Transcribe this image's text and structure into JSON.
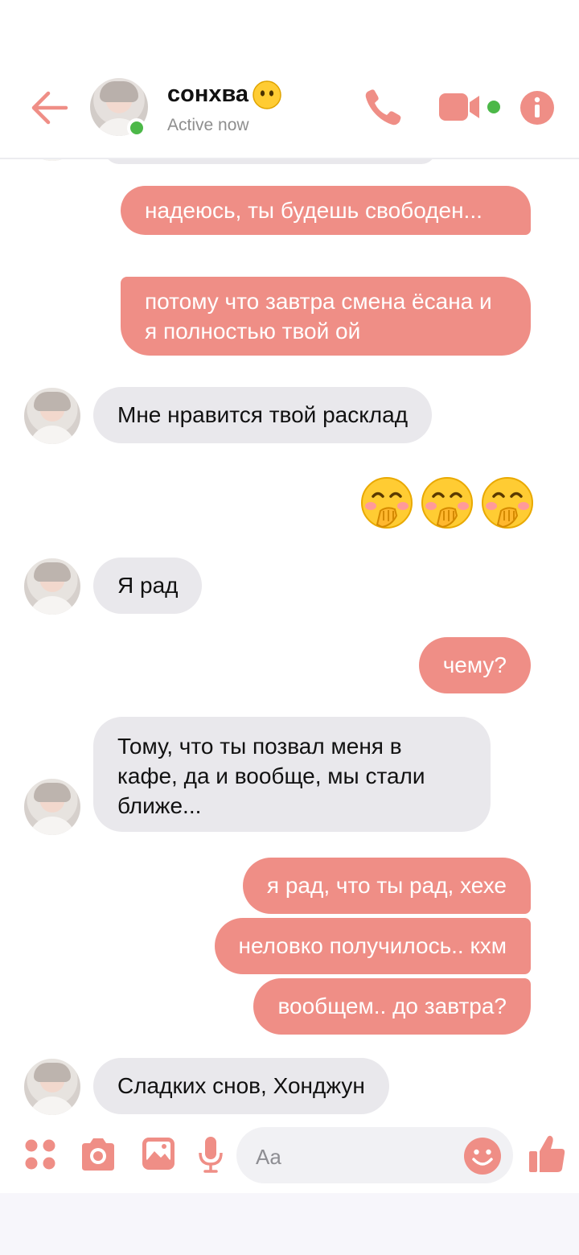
{
  "header": {
    "contact_name": "сонхва",
    "status": "Active now",
    "icons": [
      "back-arrow-icon",
      "phone-icon",
      "video-camera-icon",
      "info-icon"
    ],
    "name_emoji": "no-mouth-face-emoji",
    "accent_color": "#ef8e86",
    "online_color": "#4cb848"
  },
  "messages": [
    {
      "dir": "out",
      "text": "надеюсь, ты будешь свободен..."
    },
    {
      "dir": "out",
      "text": "потому что завтра смена ёсана и я полностью твой ой"
    },
    {
      "dir": "in",
      "text": "Мне нравится твой расклад"
    },
    {
      "dir": "out",
      "type": "emoji",
      "emoji": "hand-over-mouth-face-emoji",
      "count": 3
    },
    {
      "dir": "in",
      "text": "Я рад"
    },
    {
      "dir": "out",
      "text": "чему?"
    },
    {
      "dir": "in",
      "text": "Тому, что ты позвал меня в кафе, да и вообще, мы стали ближе..."
    },
    {
      "dir": "out",
      "text": "я рад, что ты рад, хехе"
    },
    {
      "dir": "out",
      "text": "неловко получилось.. кхм"
    },
    {
      "dir": "out",
      "text": "вообщем.. до завтра?"
    },
    {
      "dir": "in",
      "text": "Сладких снов, Хонджун"
    }
  ],
  "composer": {
    "placeholder": "Aa",
    "icons": [
      "apps-icon",
      "camera-icon",
      "gallery-icon",
      "microphone-icon",
      "emoji-icon",
      "thumbs-up-icon"
    ]
  },
  "colors": {
    "outgoing_bubble": "#ef8e86",
    "incoming_bubble": "#e9e8ec",
    "outgoing_text": "#ffffff",
    "incoming_text": "#111111"
  }
}
